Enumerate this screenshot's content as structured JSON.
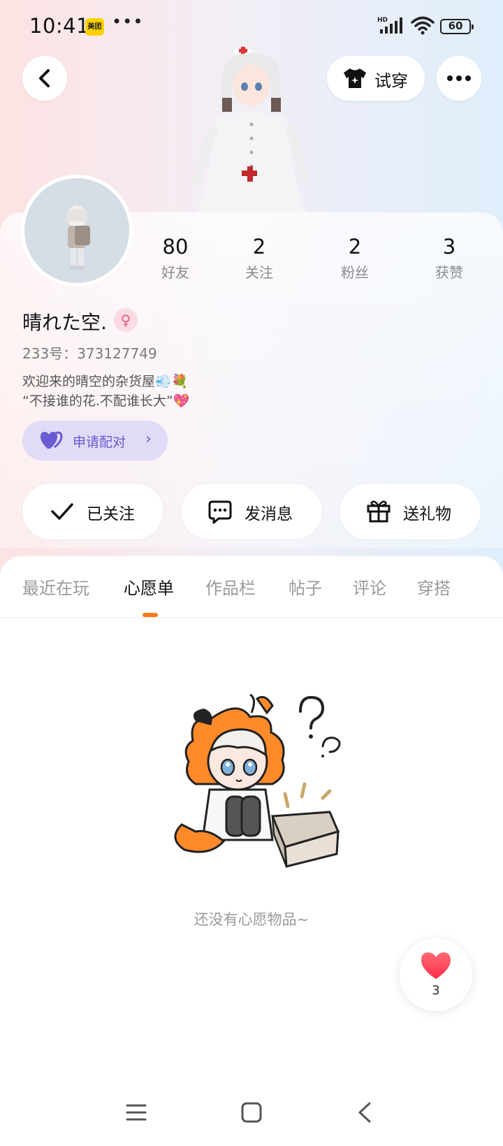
{
  "status_bar": {
    "time": "10:41",
    "app_badge": "美团",
    "more": "•••",
    "battery": "60"
  },
  "header": {
    "tryon_label": "试穿"
  },
  "profile": {
    "stats": [
      {
        "value": "80",
        "label": "好友"
      },
      {
        "value": "2",
        "label": "关注"
      },
      {
        "value": "2",
        "label": "粉丝"
      },
      {
        "value": "3",
        "label": "获赞"
      }
    ],
    "username": "晴れた空.",
    "uid_label": "233号：",
    "uid": "373127749",
    "bio_line1": "欢迎来的晴空的杂货屋💨💐",
    "bio_line2": "“不接谁的花.不配谁长大”💖",
    "pair_label": "申请配对"
  },
  "actions": {
    "following_label": "已关注",
    "message_label": "发消息",
    "gift_label": "送礼物"
  },
  "tabs": [
    {
      "label": "最近在玩"
    },
    {
      "label": "心愿单"
    },
    {
      "label": "作品栏"
    },
    {
      "label": "帖子"
    },
    {
      "label": "评论"
    },
    {
      "label": "穿搭"
    }
  ],
  "active_tab": "心愿单",
  "empty_state": {
    "text": "还没有心愿物品~"
  },
  "like_fab": {
    "count": "3"
  },
  "colors": {
    "accent": "#ff7a1a",
    "pair_purple": "#6a5bd2",
    "heart_red": "#ff4d5a"
  }
}
